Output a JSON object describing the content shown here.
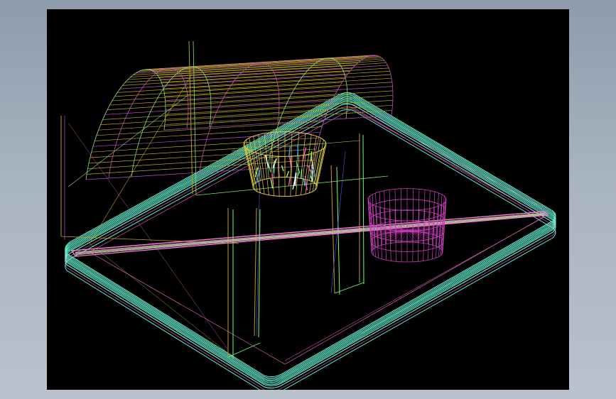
{
  "viewport": {
    "background": "#000000",
    "colors": {
      "tray": "#5fe8d0",
      "tray_inner": "#7fffd4",
      "tray_edge_magenta": "#ff6fd0",
      "tunnel": "#b8a020",
      "tunnel_magenta": "#c050c0",
      "tunnel_green": "#90e070",
      "pot_magenta": "#d040c0",
      "pot_yellow": "#e0d040",
      "rod_pink": "#ff80e0",
      "rod_green": "#80ff60",
      "leg_green": "#70ff70"
    },
    "icons": [
      "wireframe-tray",
      "wireframe-tunnel-cover",
      "wireframe-pot-yellow",
      "wireframe-pot-magenta"
    ]
  }
}
